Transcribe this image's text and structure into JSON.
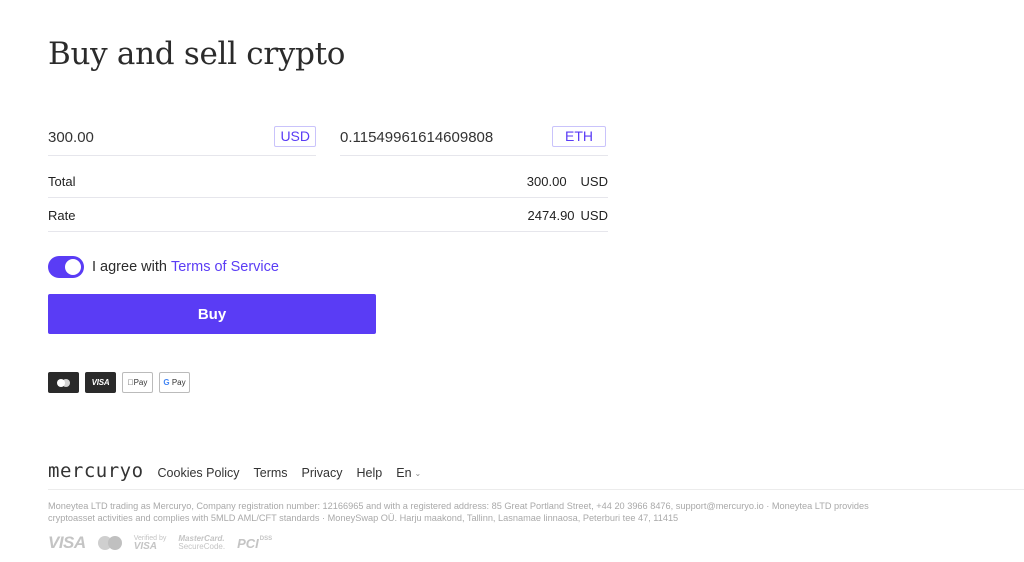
{
  "page": {
    "title": "Buy and sell crypto"
  },
  "exchange": {
    "from": {
      "amount": "300.00",
      "currency": "USD"
    },
    "to": {
      "amount": "0.11549961614609808",
      "currency": "ETH"
    }
  },
  "summary": {
    "total": {
      "label": "Total",
      "amount": "300.00",
      "currency": "USD"
    },
    "rate": {
      "label": "Rate",
      "amount": "2474.90",
      "currency": "USD"
    }
  },
  "agreement": {
    "checked": true,
    "text": "I agree with",
    "link_label": "Terms of Service"
  },
  "buy_button": {
    "label": "Buy"
  },
  "payment_methods": [
    {
      "name": "mastercard",
      "icon": "mastercard-icon"
    },
    {
      "name": "visa",
      "label": "VISA",
      "icon": "visa-icon"
    },
    {
      "name": "apple-pay",
      "label": "Pay",
      "icon": "apple-pay-icon"
    },
    {
      "name": "google-pay",
      "label_g": "G",
      "label": "Pay",
      "icon": "google-pay-icon"
    }
  ],
  "footer": {
    "logo": "mercuryo",
    "links": [
      "Cookies Policy",
      "Terms",
      "Privacy",
      "Help"
    ],
    "language": "En",
    "legal_line1": "Moneytea LTD trading as Mercuryo, Company registration number: 12166965 and with a registered address: 85 Great Portland Street, +44 20 3966 8476, support@mercuryo.io · Moneytea LTD provides",
    "legal_line2": "cryptoasset activities and complies with 5MLD AML/CFT standards · MoneySwap OÜ. Harju maakond, Tallinn, Lasnamae linnaosa, Peterburi tee 47, 11415",
    "trust_badges": {
      "visa": "VISA",
      "verified_by": "Verified by",
      "verified_visa": "VISA",
      "mc_line1": "MasterCard.",
      "mc_line2": "SecureCode.",
      "pci": "PCI",
      "pci_dss": "DSS"
    }
  },
  "colors": {
    "accent": "#5a3cf5",
    "text": "#222222",
    "muted": "#a9a9a9"
  }
}
